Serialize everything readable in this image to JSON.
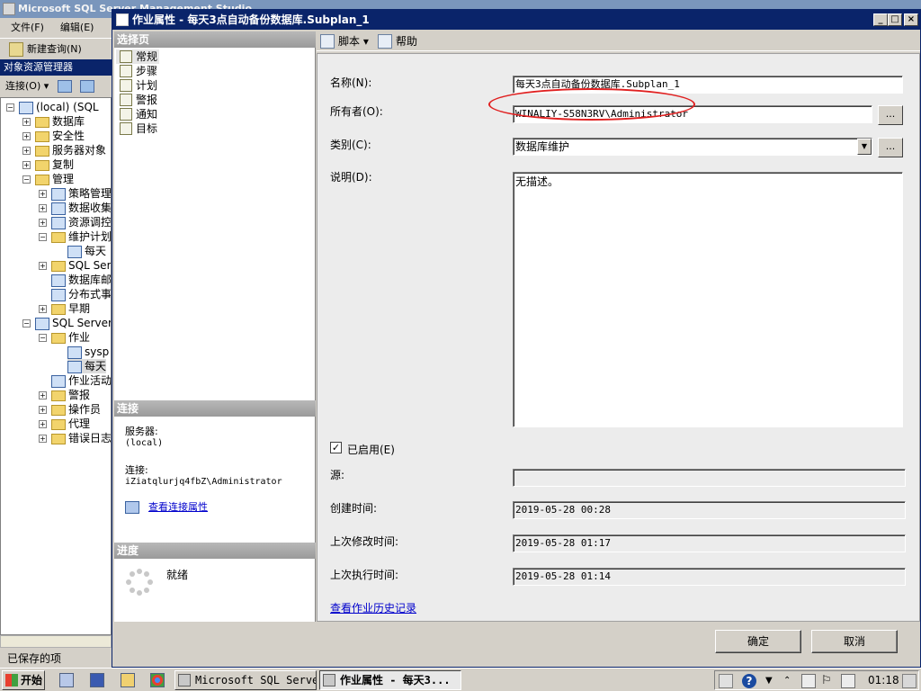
{
  "ssms": {
    "title": "Microsoft SQL Server Management Studio",
    "menu": [
      "文件(F)",
      "编辑(E)"
    ],
    "toolbar_new_query": "新建查询(N)",
    "object_explorer_title": "对象资源管理器",
    "connect_label": "连接(O)",
    "tree": [
      {
        "text": "(local) (SQL",
        "level": 0,
        "expander": "−",
        "icon": "server-icon"
      },
      {
        "text": "数据库",
        "level": 1,
        "expander": "+",
        "icon": "folder-icon"
      },
      {
        "text": "安全性",
        "level": 1,
        "expander": "+",
        "icon": "folder-icon"
      },
      {
        "text": "服务器对象",
        "level": 1,
        "expander": "+",
        "icon": "folder-icon"
      },
      {
        "text": "复制",
        "level": 1,
        "expander": "+",
        "icon": "folder-icon"
      },
      {
        "text": "管理",
        "level": 1,
        "expander": "−",
        "icon": "folder-icon"
      },
      {
        "text": "策略管理",
        "level": 2,
        "expander": "+",
        "icon": "policy-icon"
      },
      {
        "text": "数据收集",
        "level": 2,
        "expander": "+",
        "icon": "data-collection-icon"
      },
      {
        "text": "资源调控",
        "level": 2,
        "expander": "+",
        "icon": "resource-governor-icon"
      },
      {
        "text": "维护计划",
        "level": 2,
        "expander": "−",
        "icon": "folder-icon"
      },
      {
        "text": "每天",
        "level": 3,
        "expander": "",
        "icon": "maintenance-plan-icon"
      },
      {
        "text": "SQL Ser",
        "level": 2,
        "expander": "+",
        "icon": "folder-icon"
      },
      {
        "text": "数据库邮",
        "level": 2,
        "expander": "",
        "icon": "database-mail-icon"
      },
      {
        "text": "分布式事",
        "level": 2,
        "expander": "",
        "icon": "distributed-transaction-icon"
      },
      {
        "text": "早期",
        "level": 2,
        "expander": "+",
        "icon": "folder-icon"
      },
      {
        "text": "SQL Server",
        "level": 1,
        "expander": "−",
        "icon": "sql-agent-icon"
      },
      {
        "text": "作业",
        "level": 2,
        "expander": "−",
        "icon": "folder-icon"
      },
      {
        "text": "sysp",
        "level": 3,
        "expander": "",
        "icon": "job-icon"
      },
      {
        "text": "每天",
        "level": 3,
        "expander": "",
        "icon": "job-icon",
        "selected": true
      },
      {
        "text": "作业活动",
        "level": 2,
        "expander": "",
        "icon": "job-activity-icon"
      },
      {
        "text": "警报",
        "level": 2,
        "expander": "+",
        "icon": "folder-icon"
      },
      {
        "text": "操作员",
        "level": 2,
        "expander": "+",
        "icon": "folder-icon"
      },
      {
        "text": "代理",
        "level": 2,
        "expander": "+",
        "icon": "folder-icon"
      },
      {
        "text": "错误日志",
        "level": 2,
        "expander": "+",
        "icon": "folder-icon"
      }
    ],
    "status_saved": "已保存的项"
  },
  "dialog": {
    "title": "作业属性 - 每天3点自动备份数据库.Subplan_1",
    "select_page_header": "选择页",
    "pages": [
      "常规",
      "步骤",
      "计划",
      "警报",
      "通知",
      "目标"
    ],
    "connection_header": "连接",
    "server_label": "服务器:",
    "server_value": "(local)",
    "connection_label": "连接:",
    "connection_value": "iZiatqlurjq4fbZ\\Administrator",
    "view_connection_props": "查看连接属性",
    "progress_header": "进度",
    "progress_status": "就绪",
    "toolbar": {
      "script": "脚本",
      "help": "帮助"
    },
    "fields": {
      "name_label": "名称(N):",
      "name_value": "每天3点自动备份数据库.Subplan_1",
      "owner_label": "所有者(O):",
      "owner_value": "WINALIY-S58N3RV\\Administrator",
      "category_label": "类别(C):",
      "category_value": "数据库维护",
      "description_label": "说明(D):",
      "description_value": "无描述。",
      "enabled_label": "已启用(E)",
      "enabled": true,
      "source_label": "源:",
      "source_value": "",
      "created_label": "创建时间:",
      "created_value": "2019-05-28 00:28",
      "modified_label": "上次修改时间:",
      "modified_value": "2019-05-28 01:17",
      "executed_label": "上次执行时间:",
      "executed_value": "2019-05-28 01:14",
      "history_link": "查看作业历史记录",
      "browse": "..."
    },
    "ok": "确定",
    "cancel": "取消",
    "highlight_color": "#e02020"
  },
  "taskbar": {
    "start": "开始",
    "tasks": [
      "Microsoft SQL Serve...",
      "作业属性 - 每天3..."
    ],
    "clock": "01:18"
  }
}
